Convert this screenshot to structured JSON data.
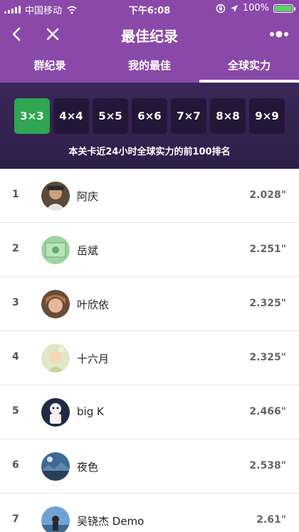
{
  "status_bar": {
    "carrier": "中国移动",
    "time": "下午6:08",
    "battery_percent": "100%",
    "battery_level": 1.0
  },
  "nav": {
    "title": "最佳纪录",
    "back_icon": "chevron-left-icon",
    "close_icon": "close-icon",
    "more_icon": "more-dots-icon"
  },
  "tabs": [
    {
      "label": "群纪录",
      "active": false
    },
    {
      "label": "我的最佳",
      "active": false
    },
    {
      "label": "全球实力",
      "active": true
    }
  ],
  "levels": [
    {
      "label": "3×3",
      "active": true
    },
    {
      "label": "4×4",
      "active": false
    },
    {
      "label": "5×5",
      "active": false
    },
    {
      "label": "6×6",
      "active": false
    },
    {
      "label": "7×7",
      "active": false
    },
    {
      "label": "8×8",
      "active": false
    },
    {
      "label": "9×9",
      "active": false
    }
  ],
  "subtitle": "本关卡近24小时全球实力的前100排名",
  "rankings": [
    {
      "rank": "1",
      "name": "阿庆",
      "time": "2.028\""
    },
    {
      "rank": "2",
      "name": "岳斌",
      "time": "2.251\""
    },
    {
      "rank": "3",
      "name": "叶欣依",
      "time": "2.325\""
    },
    {
      "rank": "4",
      "name": "十六月",
      "time": "2.325\""
    },
    {
      "rank": "5",
      "name": "big K",
      "time": "2.466\""
    },
    {
      "rank": "6",
      "name": "夜色",
      "time": "2.538\""
    },
    {
      "rank": "7",
      "name": "吴铙杰 Demo",
      "time": "2.61\""
    }
  ],
  "colors": {
    "header_purple": "#8a49a8",
    "panel_dark": "#2e1e49",
    "active_green": "#2ea652"
  }
}
